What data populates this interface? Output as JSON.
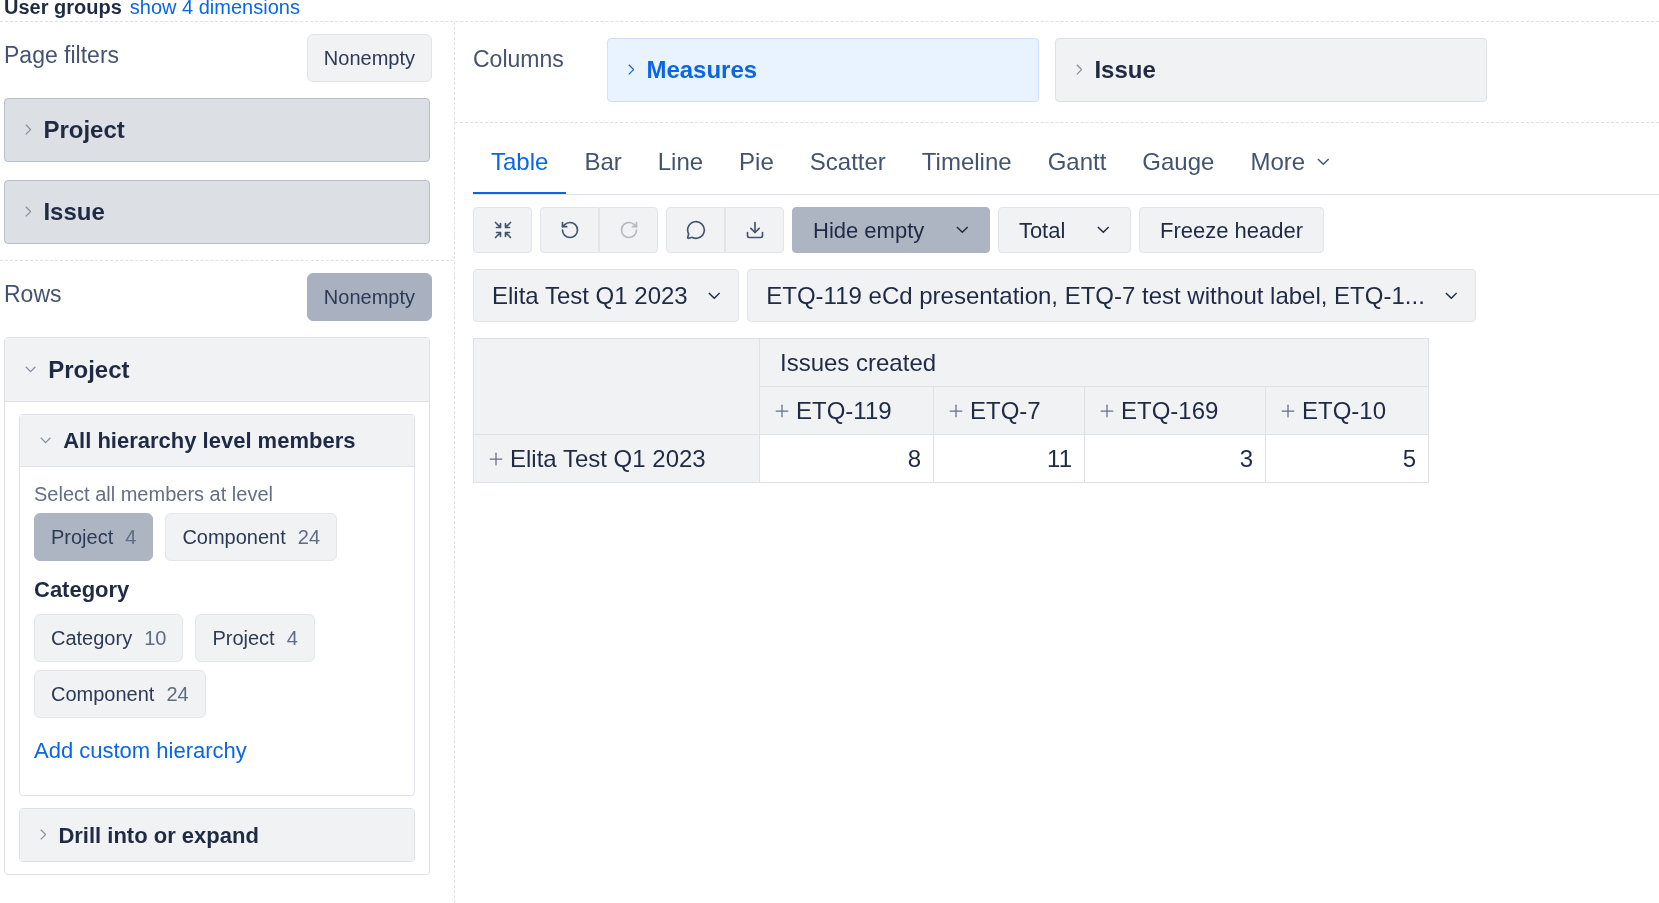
{
  "top_line": {
    "label": "User groups",
    "link": "show 4 dimensions"
  },
  "page_filters": {
    "title": "Page filters",
    "nonempty": {
      "label": "Nonempty",
      "selected": false
    },
    "items": [
      {
        "label": "Project",
        "expanded": false
      },
      {
        "label": "Issue",
        "expanded": false
      }
    ]
  },
  "rows": {
    "title": "Rows",
    "nonempty": {
      "label": "Nonempty",
      "selected": true
    },
    "dimension": {
      "label": "Project",
      "expanded": true,
      "sections": [
        {
          "title": "All hierarchy level members",
          "expanded": true,
          "hint": "Select all members at level",
          "level_chips": [
            {
              "label": "Project",
              "count": "4",
              "selected": true
            },
            {
              "label": "Component",
              "count": "24",
              "selected": false
            }
          ],
          "groups": [
            {
              "title": "Category",
              "chips": [
                {
                  "label": "Category",
                  "count": "10",
                  "selected": false
                },
                {
                  "label": "Project",
                  "count": "4",
                  "selected": false
                },
                {
                  "label": "Component",
                  "count": "24",
                  "selected": false
                }
              ]
            }
          ],
          "link": "Add custom hierarchy"
        },
        {
          "title": "Drill into or expand",
          "expanded": false
        }
      ]
    }
  },
  "columns": {
    "title": "Columns",
    "items": [
      {
        "label": "Measures",
        "selected": true
      },
      {
        "label": "Issue",
        "selected": false
      }
    ]
  },
  "tabs": [
    {
      "label": "Table",
      "selected": true
    },
    {
      "label": "Bar",
      "selected": false
    },
    {
      "label": "Line",
      "selected": false
    },
    {
      "label": "Pie",
      "selected": false
    },
    {
      "label": "Scatter",
      "selected": false
    },
    {
      "label": "Timeline",
      "selected": false
    },
    {
      "label": "Gantt",
      "selected": false
    },
    {
      "label": "Gauge",
      "selected": false
    }
  ],
  "more_tab": "More",
  "toolbar": {
    "icon_groups": [
      [
        {
          "kind": "fullscreen",
          "disabled": false
        }
      ],
      [
        {
          "kind": "undo",
          "disabled": false
        },
        {
          "kind": "redo",
          "disabled": true
        }
      ],
      [
        {
          "kind": "comment",
          "disabled": false
        },
        {
          "kind": "download",
          "disabled": false
        }
      ]
    ],
    "dropdowns": [
      {
        "label": "Hide empty",
        "selected": true
      },
      {
        "label": "Total",
        "selected": false
      }
    ],
    "freeze": "Freeze header"
  },
  "selectors": [
    {
      "label": "Elita Test Q1 2023"
    },
    {
      "label": "ETQ-119 eCd presentation, ETQ-7 test without label, ETQ-1..."
    }
  ],
  "table": {
    "measure": "Issues created",
    "columns": [
      "ETQ-119",
      "ETQ-7",
      "ETQ-169",
      "ETQ-10"
    ],
    "rows": [
      {
        "label": "Elita Test Q1 2023",
        "values": [
          "8",
          "11",
          "3",
          "5"
        ]
      }
    ]
  }
}
